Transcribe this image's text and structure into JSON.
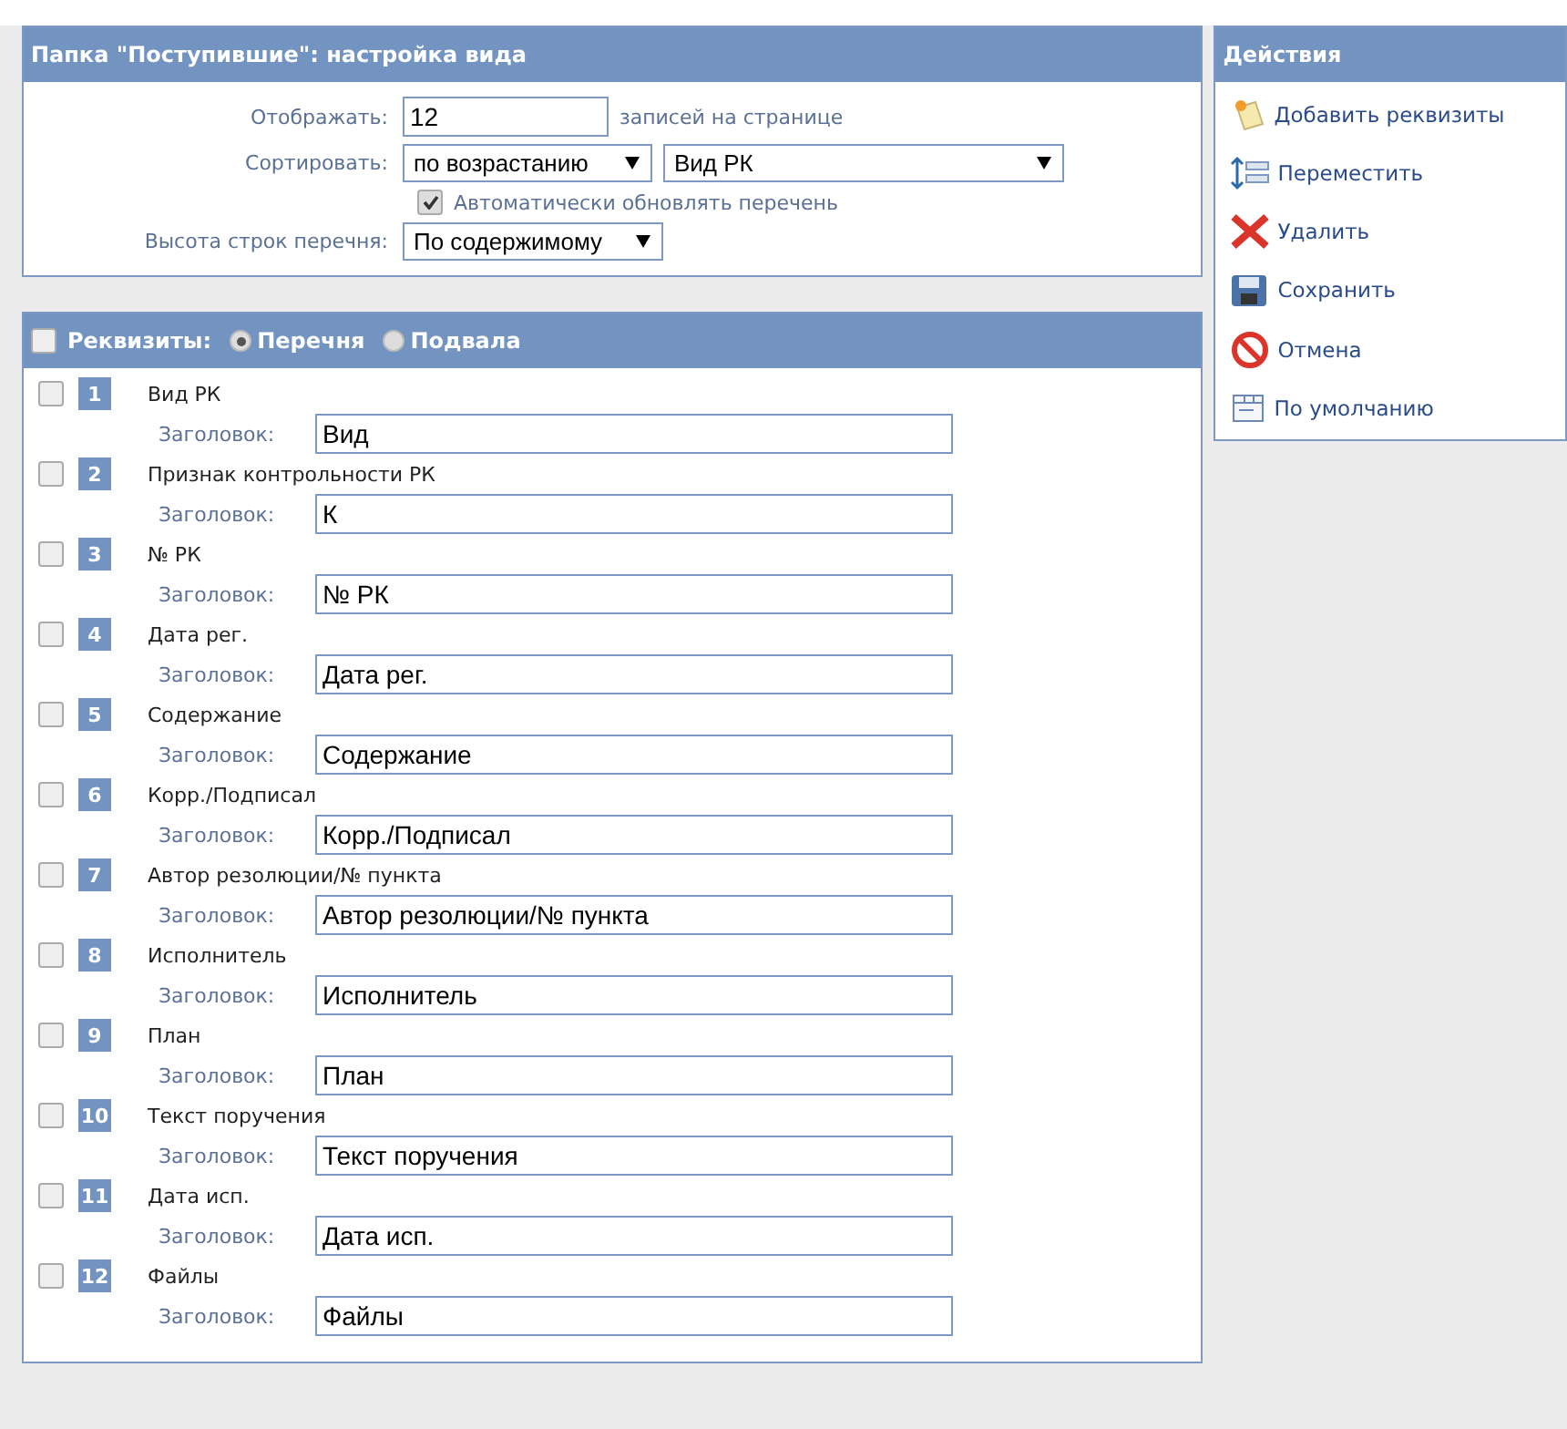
{
  "settings": {
    "title": "Папка \"Поступившие\": настройка вида",
    "display_label": "Отображать:",
    "display_value": "12",
    "display_suffix": "записей на странице",
    "sort_label": "Сортировать:",
    "sort_order": "по возрастанию",
    "sort_field": "Вид РК",
    "auto_refresh": {
      "label": "Автоматически обновлять перечень",
      "checked": true
    },
    "row_height_label": "Высота строк перечня:",
    "row_height": "По содержимому"
  },
  "attributes": {
    "select_all": {
      "label": "Реквизиты:",
      "checked": false
    },
    "modes": [
      {
        "label": "Перечня",
        "selected": true
      },
      {
        "label": "Подвала",
        "selected": false
      }
    ],
    "items": [
      {
        "number": "1",
        "name": "Вид РК",
        "caption_label": "Заголовок:",
        "caption": "Вид",
        "checked": false
      },
      {
        "number": "2",
        "name": "Признак контрольности РК",
        "caption_label": "Заголовок:",
        "caption": "К",
        "checked": false
      },
      {
        "number": "3",
        "name": "№ РК",
        "caption_label": "Заголовок:",
        "caption": "№ РК",
        "checked": false
      },
      {
        "number": "4",
        "name": "Дата рег.",
        "caption_label": "Заголовок:",
        "caption": "Дата рег.",
        "checked": false
      },
      {
        "number": "5",
        "name": "Содержание",
        "caption_label": "Заголовок:",
        "caption": "Содержание",
        "checked": false
      },
      {
        "number": "6",
        "name": "Корр./Подписал",
        "caption_label": "Заголовок:",
        "caption": "Корр./Подписал",
        "checked": false
      },
      {
        "number": "7",
        "name": "Автор резолюции/№ пункта",
        "caption_label": "Заголовок:",
        "caption": "Автор резолюции/№ пункта",
        "checked": false
      },
      {
        "number": "8",
        "name": "Исполнитель",
        "caption_label": "Заголовок:",
        "caption": "Исполнитель",
        "checked": false
      },
      {
        "number": "9",
        "name": "План",
        "caption_label": "Заголовок:",
        "caption": "План",
        "checked": false
      },
      {
        "number": "10",
        "name": "Текст поручения",
        "caption_label": "Заголовок:",
        "caption": "Текст поручения",
        "checked": false
      },
      {
        "number": "11",
        "name": "Дата исп.",
        "caption_label": "Заголовок:",
        "caption": "Дата исп.",
        "checked": false
      },
      {
        "number": "12",
        "name": "Файлы",
        "caption_label": "Заголовок:",
        "caption": "Файлы",
        "checked": false
      }
    ]
  },
  "actions": {
    "title": "Действия",
    "items": [
      {
        "kind": "add",
        "label": "Добавить реквизиты"
      },
      {
        "kind": "move",
        "label": "Переместить"
      },
      {
        "kind": "delete",
        "label": "Удалить"
      },
      {
        "kind": "save",
        "label": "Сохранить"
      },
      {
        "kind": "cancel",
        "label": "Отмена"
      },
      {
        "kind": "default",
        "label": "По умолчанию"
      }
    ]
  }
}
